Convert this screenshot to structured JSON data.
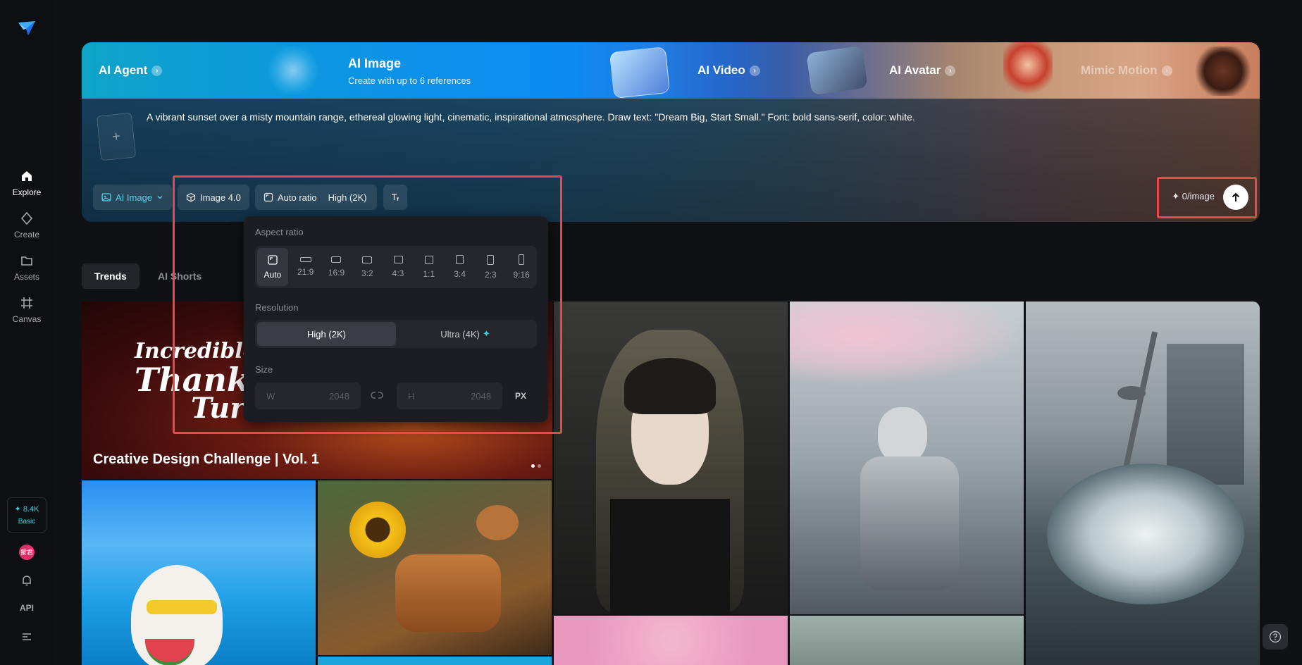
{
  "sidebar": {
    "nav": [
      {
        "label": "Explore",
        "icon": "home-icon"
      },
      {
        "label": "Create",
        "icon": "diamond-icon"
      },
      {
        "label": "Assets",
        "icon": "folder-icon"
      },
      {
        "label": "Canvas",
        "icon": "frame-icon"
      }
    ],
    "credits": {
      "amount": "✦ 8.4K",
      "plan": "Basic"
    },
    "avatar_text": "蒙君",
    "api_label": "API"
  },
  "banner": {
    "tabs": [
      {
        "label": "AI Agent",
        "icon": "arrow-right-icon"
      },
      {
        "label": "AI Video",
        "icon": "arrow-right-icon"
      },
      {
        "label": "AI Avatar",
        "icon": "arrow-right-icon"
      },
      {
        "label": "Mimic Motion",
        "icon": "arrow-right-icon"
      }
    ],
    "active": {
      "title": "AI Image",
      "subtitle": "Create with up to 6 references"
    }
  },
  "prompt": {
    "text": "A vibrant sunset over a misty mountain range, ethereal glowing light, cinematic, inspirational atmosphere. Draw text: \"Dream Big, Start Small.\" Font: bold sans-serif, color: white.",
    "add_reference": "+"
  },
  "toolbar": {
    "mode": "AI Image",
    "model": "Image 4.0",
    "ratio": "Auto ratio",
    "resolution": "High (2K)",
    "cost": "✦ 0/image"
  },
  "dropdown": {
    "aspect_label": "Aspect ratio",
    "ratios": [
      "Auto",
      "21:9",
      "16:9",
      "3:2",
      "4:3",
      "1:1",
      "3:4",
      "2:3",
      "9:16"
    ],
    "selected_ratio": "Auto",
    "resolution_label": "Resolution",
    "resolutions": [
      "High (2K)",
      "Ultra (4K)"
    ],
    "selected_resolution": "High (2K)",
    "size_label": "Size",
    "width_label": "W",
    "width_value": "2048",
    "height_label": "H",
    "height_value": "2048",
    "unit": "PX"
  },
  "subtabs": [
    "Trends",
    "AI Shorts"
  ],
  "gallery": {
    "feature_title": "Creative Design Challenge | Vol. 1",
    "feature_art": [
      "Incredible",
      "Thanksgi",
      "Tur"
    ]
  },
  "colors": {
    "accent": "#37d3e3",
    "highlight": "#e84a4a",
    "background": "#101114"
  }
}
